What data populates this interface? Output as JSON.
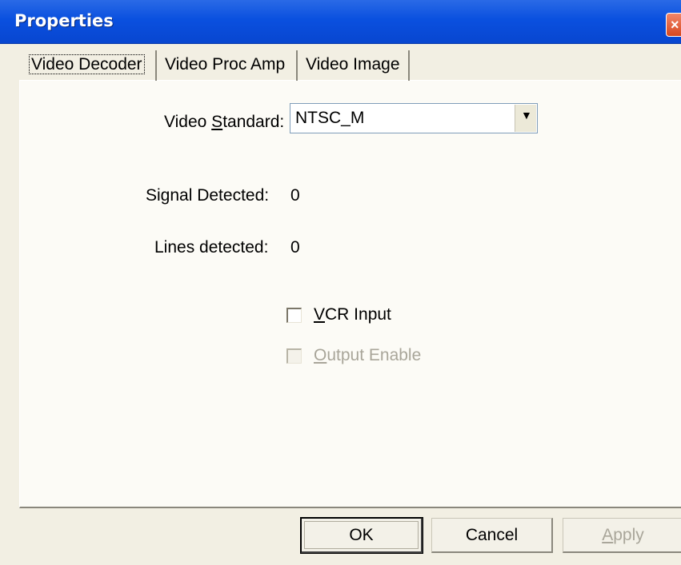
{
  "window": {
    "title": "Properties",
    "close_glyph": "×"
  },
  "tabs": [
    {
      "label": "Video Decoder",
      "active": true
    },
    {
      "label": "Video Proc Amp",
      "active": false
    },
    {
      "label": "Video Image",
      "active": false
    }
  ],
  "video_standard": {
    "label_pre": "Video ",
    "label_accel": "S",
    "label_post": "tandard:",
    "value": "NTSC_M"
  },
  "signal": {
    "label": "Signal Detected:",
    "value": "0"
  },
  "lines": {
    "label": "Lines detected:",
    "value": "0"
  },
  "vcr_input": {
    "accel": "V",
    "label_rest": "CR Input",
    "checked": false
  },
  "output_enable": {
    "accel": "O",
    "label_rest": "utput Enable",
    "checked": false,
    "disabled": true
  },
  "buttons": {
    "ok": "OK",
    "cancel": "Cancel",
    "apply_accel": "A",
    "apply_rest": "pply"
  }
}
